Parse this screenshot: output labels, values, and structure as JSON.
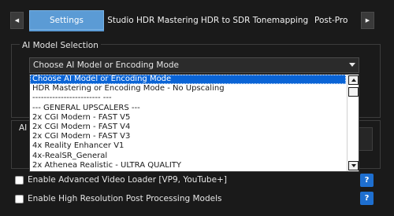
{
  "tabs": [
    {
      "label": "Settings",
      "active": true
    },
    {
      "label": "Studio HDR Mastering",
      "active": false
    },
    {
      "label": "HDR to SDR Tonemapping",
      "active": false
    },
    {
      "label": "Post-Pro",
      "active": false
    }
  ],
  "tab_scroll": {
    "left_icon": "triangle-left-icon",
    "right_icon": "triangle-right-icon"
  },
  "ai_model_group": {
    "title": "AI Model Selection",
    "combo_value": "Choose AI Model or Encoding Mode",
    "options": [
      "Choose AI Model or Encoding Mode",
      "HDR Mastering or Encoding Mode - No Upscaling",
      "------------------------ ---",
      "--- GENERAL UPSCALERS ---",
      "2x CGI Modern - FAST V5",
      "2x CGI Modern - FAST V4",
      "2x CGI Modern - FAST V3",
      "4x Reality Enhancer V1",
      "4x-RealSR_General",
      "2x Athenea Realistic - ULTRA QUALITY"
    ],
    "selected_index": 0
  },
  "second_group": {
    "title_partial": "AI"
  },
  "checkboxes": [
    {
      "label": "Enable Advanced Video Loader [VP9, YouTube+]",
      "checked": false,
      "help": "?"
    },
    {
      "label": "Enable High Resolution Post Processing Models",
      "checked": false,
      "help": "?"
    }
  ],
  "colors": {
    "background": "#1a1a1a",
    "accent": "#5b9bd5",
    "selection": "#0a64d6",
    "help_button": "#1e6fd0"
  }
}
